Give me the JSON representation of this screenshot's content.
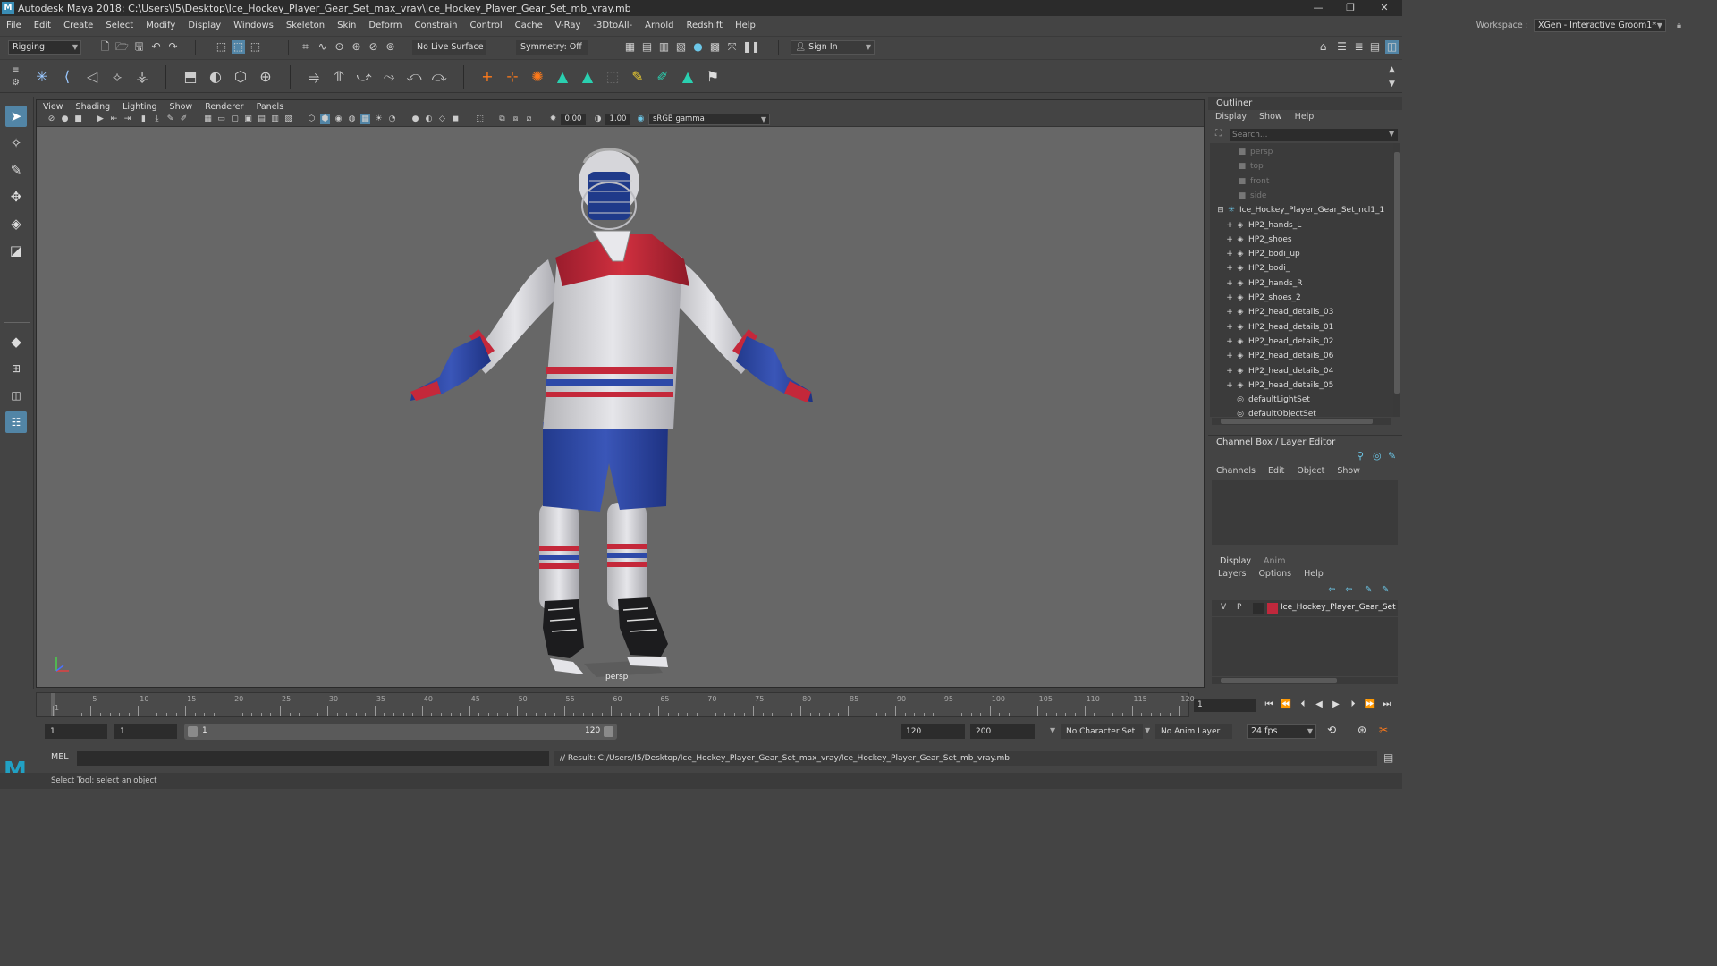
{
  "window": {
    "title": "Autodesk Maya 2018: C:\\Users\\I5\\Desktop\\Ice_Hockey_Player_Gear_Set_max_vray\\Ice_Hockey_Player_Gear_Set_mb_vray.mb",
    "logo": "M"
  },
  "menubar": [
    "File",
    "Edit",
    "Create",
    "Select",
    "Modify",
    "Display",
    "Windows",
    "Skeleton",
    "Skin",
    "Deform",
    "Constrain",
    "Control",
    "Cache",
    "V-Ray",
    "-3DtoAll-",
    "Arnold",
    "Redshift",
    "Help"
  ],
  "workspace": {
    "label": "Workspace :",
    "value": "XGen - Interactive Groom1*"
  },
  "statusline": {
    "menuset": "Rigging",
    "live_surface": "No Live Surface",
    "symmetry": "Symmetry: Off",
    "sign_in": "Sign In"
  },
  "viewport": {
    "menus": [
      "View",
      "Shading",
      "Lighting",
      "Show",
      "Renderer",
      "Panels"
    ],
    "exposure": "0.00",
    "gamma": "1.00",
    "color_space": "sRGB gamma",
    "camera": "persp"
  },
  "outliner": {
    "title": "Outliner",
    "menus": [
      "Display",
      "Show",
      "Help"
    ],
    "search_placeholder": "Search...",
    "items": [
      {
        "label": "persp",
        "dim": true
      },
      {
        "label": "top",
        "dim": true
      },
      {
        "label": "front",
        "dim": true
      },
      {
        "label": "side",
        "dim": true
      },
      {
        "label": "Ice_Hockey_Player_Gear_Set_ncl1_1"
      },
      {
        "label": "HP2_hands_L"
      },
      {
        "label": "HP2_shoes"
      },
      {
        "label": "HP2_bodi_up"
      },
      {
        "label": "HP2_bodi_"
      },
      {
        "label": "HP2_hands_R"
      },
      {
        "label": "HP2_shoes_2"
      },
      {
        "label": "HP2_head_details_03"
      },
      {
        "label": "HP2_head_details_01"
      },
      {
        "label": "HP2_head_details_02"
      },
      {
        "label": "HP2_head_details_06"
      },
      {
        "label": "HP2_head_details_04"
      },
      {
        "label": "HP2_head_details_05"
      },
      {
        "label": "defaultLightSet"
      },
      {
        "label": "defaultObjectSet"
      }
    ]
  },
  "channelbox": {
    "title": "Channel Box / Layer Editor",
    "menus": [
      "Channels",
      "Edit",
      "Object",
      "Show"
    ]
  },
  "layer_editor": {
    "tabs": [
      "Display",
      "Anim"
    ],
    "menus": [
      "Layers",
      "Options",
      "Help"
    ],
    "layer": {
      "v": "V",
      "p": "P",
      "name": "Ice_Hockey_Player_Gear_Set",
      "color": "#c0283c"
    }
  },
  "timeslider": {
    "labels": [
      "1",
      "5",
      "10",
      "15",
      "20",
      "25",
      "30",
      "35",
      "40",
      "45",
      "50",
      "55",
      "60",
      "65",
      "70",
      "75",
      "80",
      "85",
      "90",
      "95",
      "100",
      "105",
      "110",
      "115",
      "120"
    ],
    "current_frame": "1"
  },
  "range": {
    "start": "1",
    "playback_start": "1",
    "slider_start": "1",
    "slider_end": "120",
    "playback_end": "120",
    "end": "200",
    "character_set": "No Character Set",
    "anim_layer": "No Anim Layer",
    "fps": "24 fps"
  },
  "cmdline": {
    "label": "MEL",
    "result": "// Result: C:/Users/I5/Desktop/Ice_Hockey_Player_Gear_Set_max_vray/Ice_Hockey_Player_Gear_Set_mb_vray.mb"
  },
  "helpline": "Select Tool: select an object",
  "colors": {
    "accent": "#5285a6",
    "jersey_red": "#c4283a",
    "jersey_blue": "#2d49a8",
    "viewport_bg": "#676767"
  }
}
